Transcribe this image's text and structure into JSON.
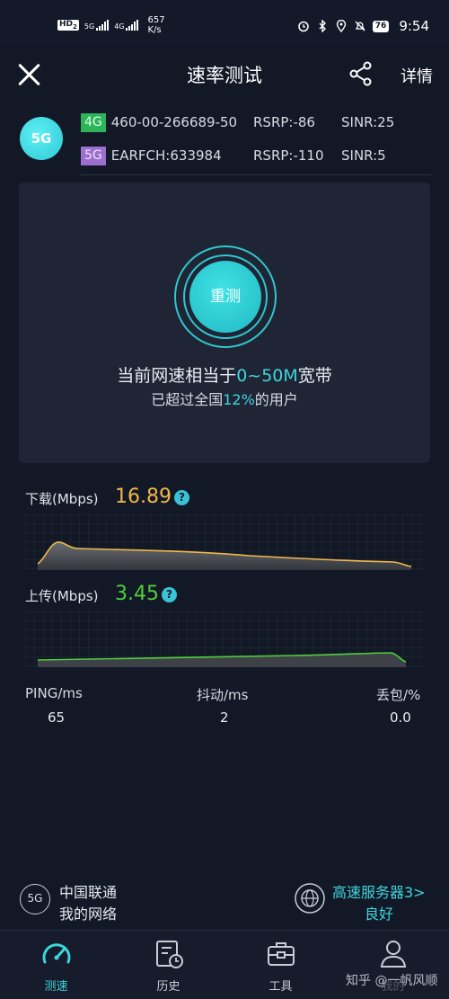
{
  "status_bar": {
    "hd": "HD",
    "hd_sub": "2",
    "sig1_label": "5G",
    "sig2_label": "4G",
    "speed_value": "657",
    "speed_unit": "K/s",
    "battery": "76",
    "time": "9:54"
  },
  "header": {
    "title": "速率测试",
    "detail_label": "详情"
  },
  "network": {
    "badge": "5G",
    "row_4g": {
      "tag": "4G",
      "id": "460-00-266689-50",
      "rsrp": "RSRP:-86",
      "sinr": "SINR:25"
    },
    "row_5g": {
      "tag": "5G",
      "id": "EARFCH:633984",
      "rsrp": "RSRP:-110",
      "sinr": "SINR:5"
    }
  },
  "result_card": {
    "retest_label": "重测",
    "line1_prefix": "当前网速相当于",
    "line1_highlight": "0~50M",
    "line1_suffix": "宽带",
    "line2_prefix": "已超过全国",
    "line2_highlight": "12%",
    "line2_suffix": "的用户"
  },
  "download": {
    "label": "下载(Mbps)",
    "value": "16.89",
    "color": "#f0b84a"
  },
  "upload": {
    "label": "上传(Mbps)",
    "value": "3.45",
    "color": "#4fce3a"
  },
  "stats": {
    "ping_label": "PING/ms",
    "ping_value": "65",
    "jitter_label": "抖动/ms",
    "jitter_value": "2",
    "loss_label": "丢包/%",
    "loss_value": "0.0"
  },
  "footer_info": {
    "carrier_badge": "5G",
    "carrier_name": "中国联通",
    "network_label": "我的网络",
    "server_name": "高速服务器3>",
    "server_status": "良好"
  },
  "nav": {
    "items": [
      {
        "label": "测速",
        "icon": "speedometer-icon",
        "active": true
      },
      {
        "label": "历史",
        "icon": "history-icon",
        "active": false
      },
      {
        "label": "工具",
        "icon": "toolbox-icon",
        "active": false
      },
      {
        "label": "我的",
        "icon": "user-icon",
        "active": false
      }
    ]
  },
  "watermark": "知乎 @一帆风顺",
  "colors": {
    "accent": "#3fd5dc",
    "background": "#121826",
    "card": "#1f2535"
  }
}
